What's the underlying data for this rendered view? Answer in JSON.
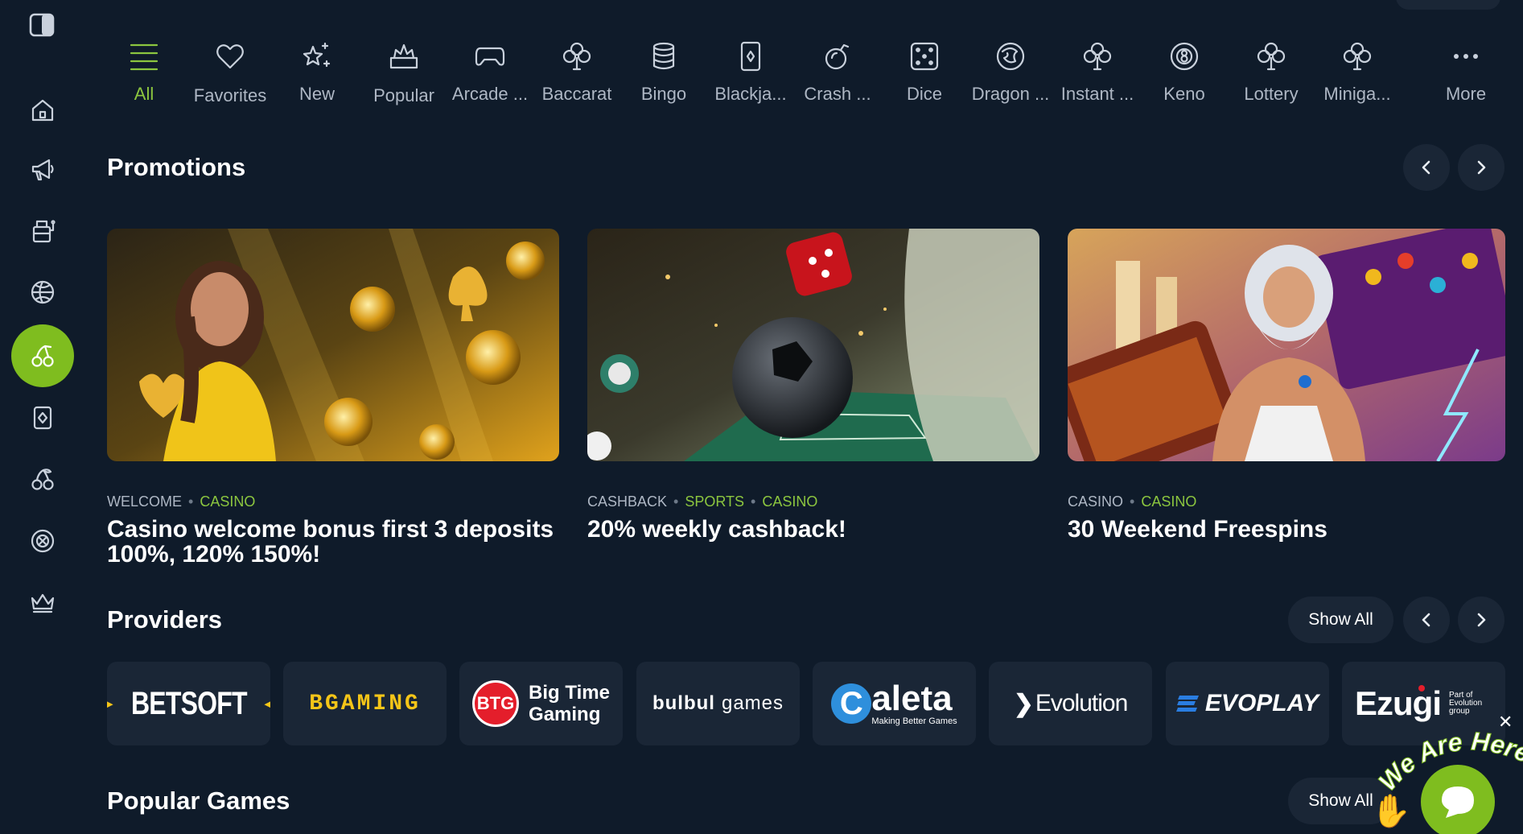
{
  "sidebar": {
    "toggle_icon": "sidebar-toggle-icon",
    "items": [
      {
        "name": "home",
        "icon": "home-icon",
        "active": false
      },
      {
        "name": "promotions",
        "icon": "megaphone-icon",
        "active": false
      },
      {
        "name": "slots",
        "icon": "slot-machine-icon",
        "active": false
      },
      {
        "name": "sports",
        "icon": "basketball-icon",
        "active": false
      },
      {
        "name": "casino",
        "icon": "cherries-icon",
        "active": true
      },
      {
        "name": "cards",
        "icon": "card-icon",
        "active": false
      },
      {
        "name": "live-casino",
        "icon": "cherries-outline-icon",
        "active": false
      },
      {
        "name": "esports",
        "icon": "target-icon",
        "active": false
      },
      {
        "name": "vip",
        "icon": "crown-icon",
        "active": false
      }
    ],
    "accent": "#7fbd1f"
  },
  "categories": [
    {
      "label": "All",
      "icon": "menu-lines-icon",
      "active": true
    },
    {
      "label": "Favorites",
      "icon": "heart-icon"
    },
    {
      "label": "New",
      "icon": "sparkle-star-icon"
    },
    {
      "label": "Popular",
      "icon": "crown-cake-icon"
    },
    {
      "label": "Arcade ...",
      "icon": "gamepad-icon"
    },
    {
      "label": "Baccarat",
      "icon": "clover-icon"
    },
    {
      "label": "Bingo",
      "icon": "coin-stack-icon"
    },
    {
      "label": "Blackja...",
      "icon": "playing-card-icon"
    },
    {
      "label": "Crash ...",
      "icon": "bomb-icon"
    },
    {
      "label": "Dice",
      "icon": "dice-icon"
    },
    {
      "label": "Dragon ...",
      "icon": "dragon-icon"
    },
    {
      "label": "Instant ...",
      "icon": "clover-icon"
    },
    {
      "label": "Keno",
      "icon": "eight-ball-icon"
    },
    {
      "label": "Lottery",
      "icon": "clover-icon"
    },
    {
      "label": "Miniga...",
      "icon": "clover-icon"
    },
    {
      "label": "More",
      "icon": "dots-icon"
    }
  ],
  "promotions": {
    "title": "Promotions",
    "cards": [
      {
        "tags": [
          "WELCOME",
          "CASINO"
        ],
        "title": "Casino welcome bonus first 3 deposits 100%, 120% 150%!",
        "image": "woman-gold-coins"
      },
      {
        "tags": [
          "CASHBACK",
          "SPORTS",
          "CASINO"
        ],
        "title": "20% weekly cashback!",
        "image": "soccer-dice"
      },
      {
        "tags": [
          "CASINO",
          "CASINO"
        ],
        "title": "30 Weekend Freespins",
        "image": "zeus-slots"
      }
    ]
  },
  "providers": {
    "title": "Providers",
    "show_all": "Show All",
    "items": [
      {
        "name": "BETSOFT",
        "color": "#f5c518"
      },
      {
        "name": "BGAMING",
        "color": "#f5c518"
      },
      {
        "name": "Big Time Gaming",
        "line1": "Big Time",
        "line2": "Gaming",
        "badge": "BTG",
        "color": "#e41e2b"
      },
      {
        "name": "bulbul games",
        "part1": "bulbul",
        "part2": "games"
      },
      {
        "name": "Caleta",
        "letter": "C",
        "rest": "aleta",
        "tagline": "Making Better Games",
        "color": "#2e8fdc"
      },
      {
        "name": "Evolution"
      },
      {
        "name": "EVOPLAY",
        "color": "#2a7de1"
      },
      {
        "name": "Ezugi",
        "tagline1": "Part of",
        "tagline2": "Evolution",
        "tagline3": "group",
        "color": "#e41e2b"
      }
    ]
  },
  "popular_games": {
    "title": "Popular Games",
    "show_all": "Show All"
  },
  "chat": {
    "label": "We Are Here!",
    "close": "✕"
  }
}
